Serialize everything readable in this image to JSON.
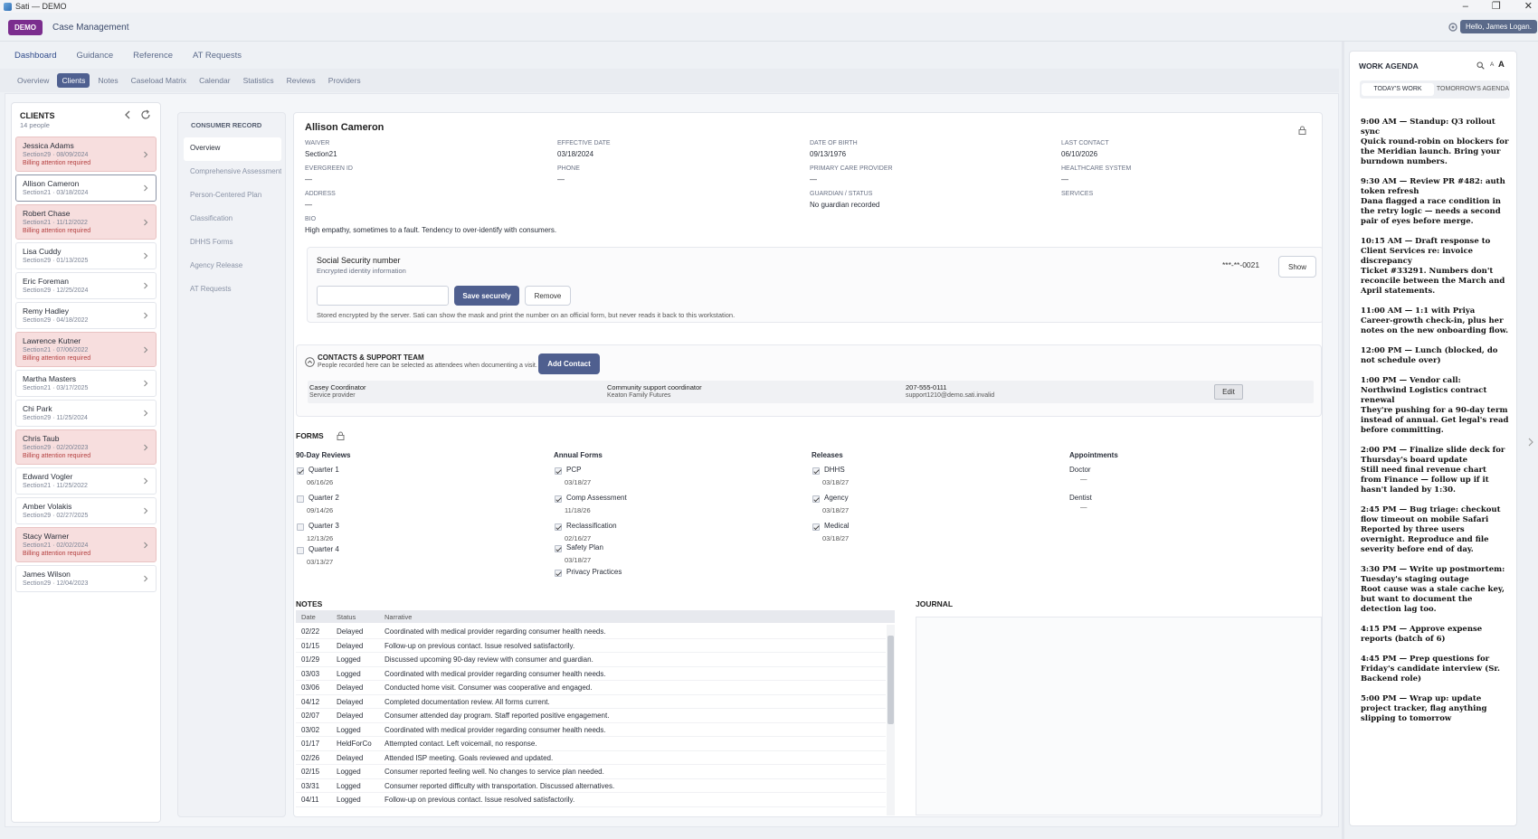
{
  "window": {
    "title": "Sati — DEMO",
    "controls": [
      "–",
      "❐",
      "✕"
    ]
  },
  "header": {
    "badge": "DEMO",
    "app_title": "Case Management",
    "user": "Hello, James Logan."
  },
  "nav": {
    "primary": [
      "Dashboard",
      "Guidance",
      "Reference",
      "AT Requests"
    ],
    "secondary": [
      "Overview",
      "Clients",
      "Notes",
      "Caseload Matrix",
      "Calendar",
      "Statistics",
      "Reviews",
      "Providers"
    ]
  },
  "clients": {
    "title": "CLIENTS",
    "count": "14 people",
    "items": [
      {
        "name": "Jessica Adams",
        "sub": "Section29 · 08/09/2024",
        "warn": "Billing attention required"
      },
      {
        "name": "Allison Cameron",
        "sub": "Section21 · 03/18/2024",
        "warn": ""
      },
      {
        "name": "Robert Chase",
        "sub": "Section21 · 11/12/2022",
        "warn": "Billing attention required"
      },
      {
        "name": "Lisa Cuddy",
        "sub": "Section29 · 01/13/2025",
        "warn": ""
      },
      {
        "name": "Eric Foreman",
        "sub": "Section29 · 12/25/2024",
        "warn": ""
      },
      {
        "name": "Remy Hadley",
        "sub": "Section29 · 04/18/2022",
        "warn": ""
      },
      {
        "name": "Lawrence Kutner",
        "sub": "Section21 · 07/06/2022",
        "warn": "Billing attention required"
      },
      {
        "name": "Martha Masters",
        "sub": "Section21 · 03/17/2025",
        "warn": ""
      },
      {
        "name": "Chi Park",
        "sub": "Section29 · 11/25/2024",
        "warn": ""
      },
      {
        "name": "Chris Taub",
        "sub": "Section29 · 02/20/2023",
        "warn": "Billing attention required"
      },
      {
        "name": "Edward Vogler",
        "sub": "Section21 · 11/25/2022",
        "warn": ""
      },
      {
        "name": "Amber Volakis",
        "sub": "Section29 · 02/27/2025",
        "warn": ""
      },
      {
        "name": "Stacy Warner",
        "sub": "Section21 · 02/02/2024",
        "warn": "Billing attention required"
      },
      {
        "name": "James Wilson",
        "sub": "Section29 · 12/04/2023",
        "warn": ""
      }
    ]
  },
  "record_nav": {
    "title": "CONSUMER RECORD",
    "items": [
      "Overview",
      "Comprehensive Assessment",
      "Person-Centered Plan",
      "Classification",
      "DHHS Forms",
      "Agency Release",
      "AT Requests"
    ]
  },
  "record": {
    "name": "Allison Cameron",
    "fields": {
      "waiver_l": "WAIVER",
      "waiver": "Section21",
      "eff_l": "EFFECTIVE DATE",
      "eff": "03/18/2024",
      "dob_l": "DATE OF BIRTH",
      "dob": "09/13/1976",
      "last_l": "LAST CONTACT",
      "last": "06/10/2026",
      "evergreen_l": "EVERGREEN ID",
      "evergreen": "—",
      "phone_l": "PHONE",
      "phone": "—",
      "pcp_l": "PRIMARY CARE PROVIDER",
      "pcp": "—",
      "hs_l": "HEALTHCARE SYSTEM",
      "hs": "—",
      "addr_l": "ADDRESS",
      "addr": "—",
      "guard_l": "GUARDIAN / STATUS",
      "guard": "No guardian recorded",
      "svc_l": "SERVICES",
      "bio_l": "BIO",
      "bio": "High empathy, sometimes to a fault. Tendency to over-identify with consumers."
    },
    "ssn": {
      "title": "Social Security number",
      "sub": "Encrypted identity information",
      "masked": "***-**-0021",
      "show": "Show",
      "save": "Save securely",
      "remove": "Remove",
      "note": "Stored encrypted by the server. Sati can show the mask and print the number on an official form, but never reads it back to this workstation."
    },
    "contacts": {
      "title": "CONTACTS & SUPPORT TEAM",
      "sub": "People recorded here can be selected as attendees when documenting a visit.",
      "add": "Add Contact",
      "row": {
        "name": "Casey Coordinator",
        "type": "Service provider",
        "role": "Community support coordinator",
        "org": "Keaton Family Futures",
        "phone": "207-555-0111",
        "email": "support1210@demo.sati.invalid",
        "edit": "Edit"
      }
    },
    "forms": {
      "title": "FORMS",
      "reviews": {
        "title": "90-Day Reviews",
        "items": [
          {
            "label": "Quarter 1",
            "date": "06/16/26",
            "checked": true
          },
          {
            "label": "Quarter 2",
            "date": "09/14/26",
            "checked": false
          },
          {
            "label": "Quarter 3",
            "date": "12/13/26",
            "checked": false
          },
          {
            "label": "Quarter 4",
            "date": "03/13/27",
            "checked": false
          }
        ]
      },
      "annual": {
        "title": "Annual Forms",
        "items": [
          {
            "label": "PCP",
            "date": "03/18/27",
            "checked": true
          },
          {
            "label": "Comp Assessment",
            "date": "11/18/26",
            "checked": true
          },
          {
            "label": "Reclassification",
            "date": "02/16/27",
            "checked": true
          },
          {
            "label": "Safety Plan",
            "date": "03/18/27",
            "checked": true
          },
          {
            "label": "Privacy Practices",
            "date": "",
            "checked": true
          }
        ]
      },
      "releases": {
        "title": "Releases",
        "items": [
          {
            "label": "DHHS",
            "date": "03/18/27",
            "checked": true
          },
          {
            "label": "Agency",
            "date": "03/18/27",
            "checked": true
          },
          {
            "label": "Medical",
            "date": "03/18/27",
            "checked": true
          }
        ]
      },
      "appointments": {
        "title": "Appointments",
        "items": [
          {
            "label": "Doctor",
            "value": "—"
          },
          {
            "label": "Dentist",
            "value": "—"
          }
        ]
      }
    },
    "notes": {
      "title": "NOTES",
      "cols": [
        "Date",
        "Status",
        "Narrative"
      ],
      "rows": [
        [
          "02/22",
          "Delayed",
          "Coordinated with medical provider regarding consumer health needs."
        ],
        [
          "01/15",
          "Delayed",
          "Follow-up on previous contact. Issue resolved satisfactorily."
        ],
        [
          "01/29",
          "Logged",
          "Discussed upcoming 90-day review with consumer and guardian."
        ],
        [
          "03/03",
          "Logged",
          "Coordinated with medical provider regarding consumer health needs."
        ],
        [
          "03/06",
          "Delayed",
          "Conducted home visit. Consumer was cooperative and engaged."
        ],
        [
          "04/12",
          "Delayed",
          "Completed documentation review. All forms current."
        ],
        [
          "02/07",
          "Delayed",
          "Consumer attended day program. Staff reported positive engagement."
        ],
        [
          "03/02",
          "Logged",
          "Coordinated with medical provider regarding consumer health needs."
        ],
        [
          "01/17",
          "HeldForCo",
          "Attempted contact. Left voicemail, no response."
        ],
        [
          "02/26",
          "Delayed",
          "Attended ISP meeting. Goals reviewed and updated."
        ],
        [
          "02/15",
          "Logged",
          "Consumer reported feeling well. No changes to service plan needed."
        ],
        [
          "03/31",
          "Logged",
          "Consumer reported difficulty with transportation. Discussed alternatives."
        ],
        [
          "04/11",
          "Logged",
          "Follow-up on previous contact. Issue resolved satisfactorily."
        ]
      ]
    },
    "journal": {
      "title": "JOURNAL"
    }
  },
  "agenda": {
    "title": "WORK AGENDA",
    "font_small": "A",
    "font_large": "A",
    "tabs": [
      "TODAY'S WORK",
      "TOMORROW'S AGENDA"
    ],
    "entries": [
      "9:00 AM — Standup: Q3 rollout sync\nQuick round-robin on blockers for the Meridian launch. Bring your burndown numbers.",
      "9:30 AM — Review PR #482: auth token refresh\nDana flagged a race condition in the retry logic — needs a second pair of eyes before merge.",
      "10:15 AM — Draft response to Client Services re: invoice discrepancy\nTicket #33291. Numbers don't reconcile between the March and April statements.",
      "11:00 AM — 1:1 with Priya\nCareer-growth check-in, plus her notes on the new onboarding flow.",
      "12:00 PM — Lunch (blocked, do not schedule over)",
      "1:00 PM — Vendor call: Northwind Logistics contract renewal\nThey're pushing for a 90-day term instead of annual. Get legal's read before committing.",
      "2:00 PM — Finalize slide deck for Thursday's board update\nStill need final revenue chart from Finance — follow up if it hasn't landed by 1:30.",
      "2:45 PM — Bug triage: checkout flow timeout on mobile Safari\nReported by three users overnight. Reproduce and file severity before end of day.",
      "3:30 PM — Write up postmortem: Tuesday's staging outage\nRoot cause was a stale cache key, but want to document the detection lag too.",
      "4:15 PM — Approve expense reports (batch of 6)",
      "4:45 PM — Prep questions for Friday's candidate interview (Sr. Backend role)",
      "5:00 PM — Wrap up: update project tracker, flag anything slipping to tomorrow"
    ]
  }
}
